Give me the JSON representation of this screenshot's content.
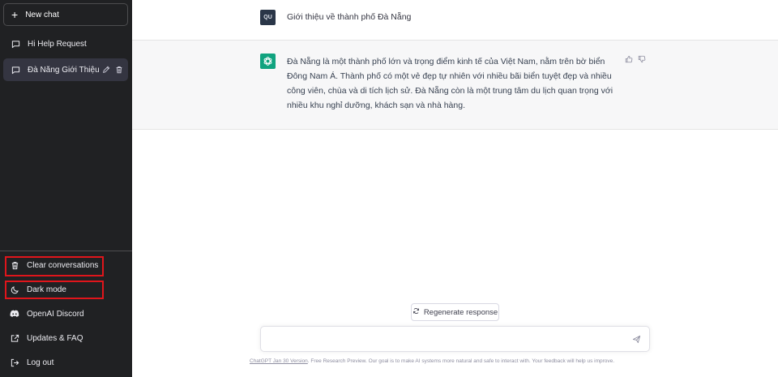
{
  "sidebar": {
    "new_chat": "New chat",
    "history": [
      {
        "label": "Hi Help Request",
        "active": false
      },
      {
        "label": "Đà Nẵng Giới Thiệu",
        "active": true
      }
    ],
    "bottom": [
      {
        "label": "Clear conversations",
        "icon": "trash-icon"
      },
      {
        "label": "Dark mode",
        "icon": "moon-icon"
      },
      {
        "label": "OpenAI Discord",
        "icon": "discord-icon"
      },
      {
        "label": "Updates & FAQ",
        "icon": "external-link-icon"
      },
      {
        "label": "Log out",
        "icon": "logout-icon"
      }
    ]
  },
  "conversation": {
    "user_avatar": "QU",
    "user_message": "Giới thiệu về thành phố Đà Nẵng",
    "assistant_message": "Đà Nẵng là một thành phố lớn và trọng điểm kinh tế của Việt Nam, nằm trên bờ biển Đông Nam Á. Thành phố có một vẻ đẹp tự nhiên với nhiều bãi biển tuyệt đẹp và nhiều công viên, chùa và di tích lịch sử. Đà Nẵng còn là một trung tâm du lịch quan trọng với nhiều khu nghỉ dưỡng, khách sạn và nhà hàng."
  },
  "composer": {
    "regenerate_label": "Regenerate response",
    "input_value": "",
    "footer_link": "ChatGPT Jan 30 Version",
    "footer_text": ". Free Research Preview. Our goal is to make AI systems more natural and safe to interact with. Your feedback will help us improve."
  },
  "colors": {
    "sidebar_bg": "#202123",
    "active_item_bg": "#343541",
    "assistant_row_bg": "#f7f7f8",
    "bot_avatar": "#10a37f",
    "highlight_box": "#e0151b"
  }
}
